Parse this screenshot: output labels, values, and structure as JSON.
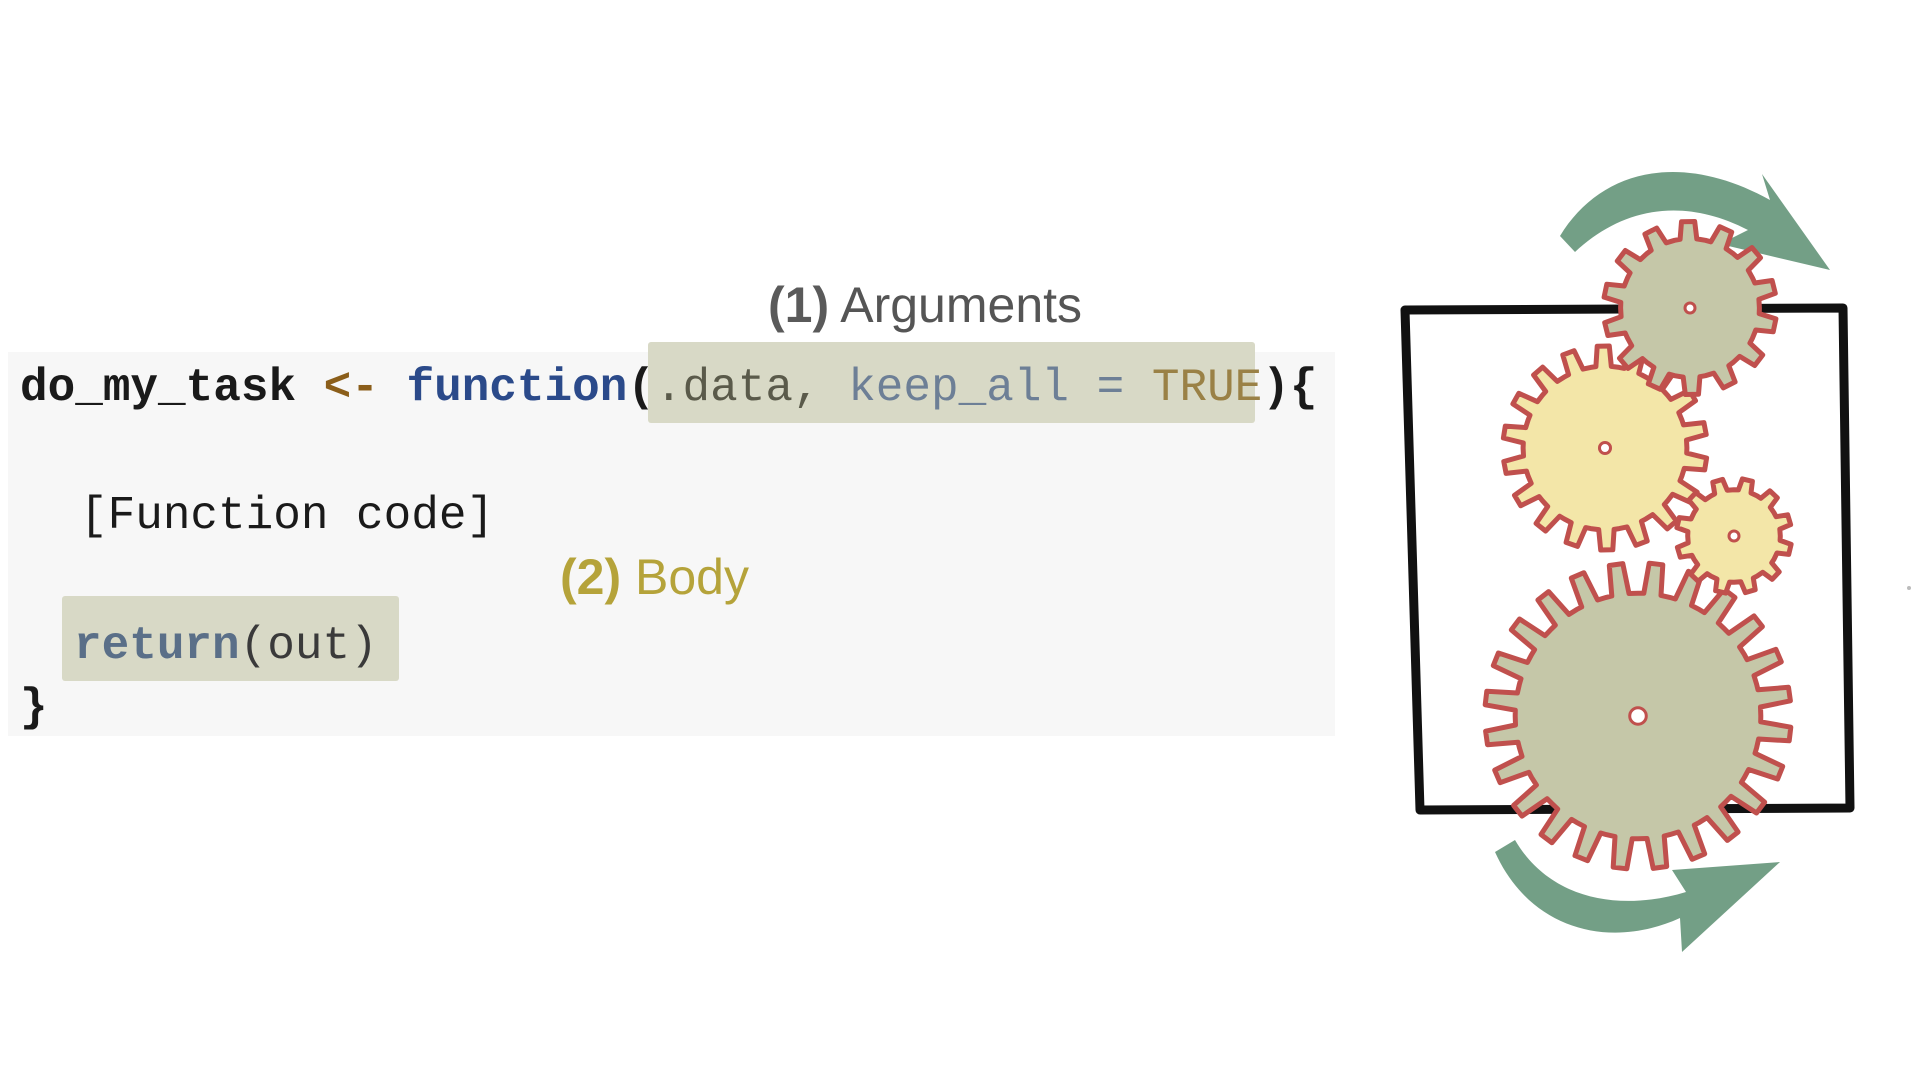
{
  "code": {
    "line1": {
      "name": "do_my_task",
      "assign": "<-",
      "keyword": "function",
      "open_paren": "(",
      "arg1": ".data,",
      "arg2": "keep_all",
      "equals": "=",
      "default": "TRUE",
      "close": "){"
    },
    "line2": "[Function code]",
    "line3": {
      "keyword": "return",
      "args": "(out)"
    },
    "line4": "}"
  },
  "labels": {
    "arguments": {
      "number": "(1)",
      "text": "Arguments"
    },
    "body": {
      "number": "(2)",
      "text": "Body"
    }
  },
  "colors": {
    "panel": "#f7f7f7",
    "highlight": "#d8d9c6",
    "gear_sage": "#c5c7a8",
    "gear_yellow": "#f3e6a8",
    "gear_outline": "#c0504d",
    "arrow": "#6b9a80",
    "frame": "#111111"
  }
}
